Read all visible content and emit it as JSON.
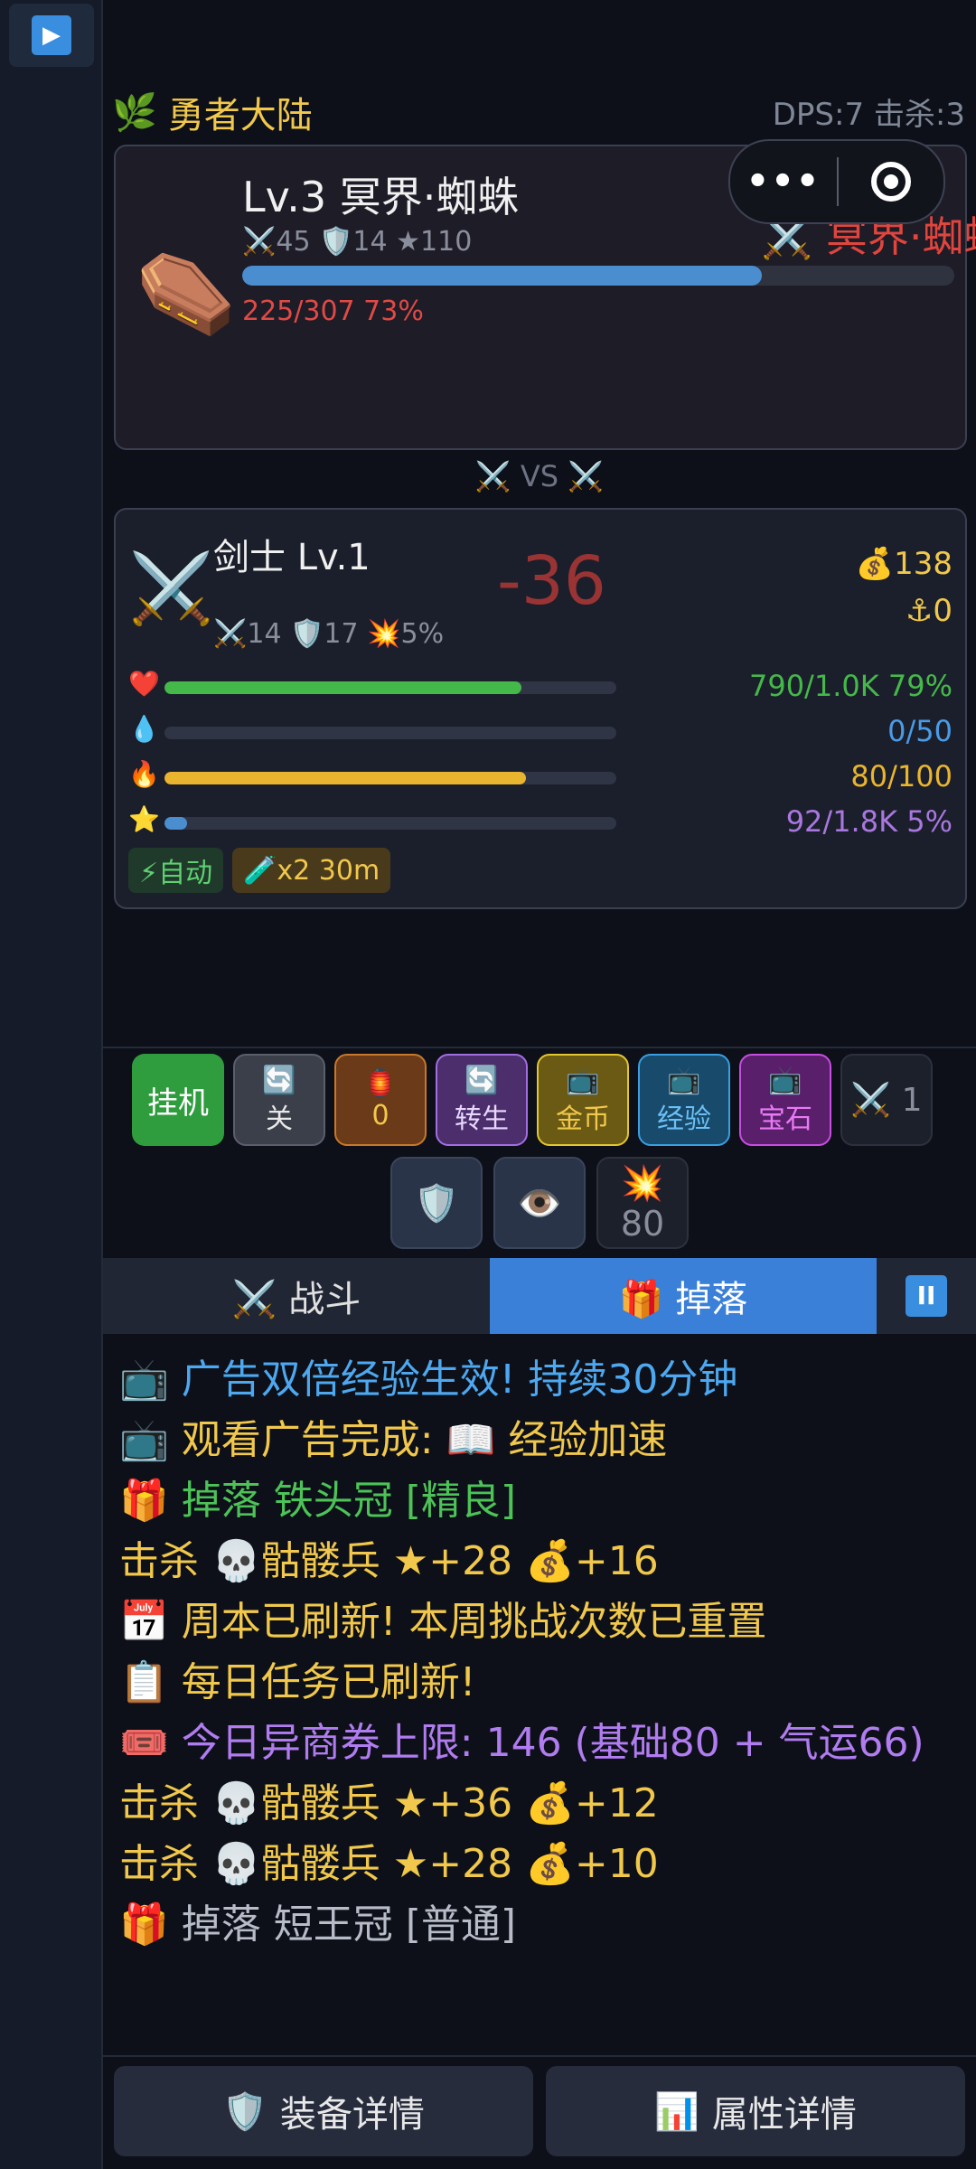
{
  "sidebar": {
    "play_icon": "play-icon"
  },
  "top": {
    "zone": "勇者大陆",
    "zone_icon": "🌿",
    "dps": "DPS:7",
    "kills": "击杀:3"
  },
  "enemy": {
    "icon": "⚰️",
    "title": "Lv.3 冥界·蜘蛛",
    "stats": "⚔️45 🛡️14 ★110",
    "hp_text": "225/307  73%",
    "hp_fraction": 0.73,
    "target_label": "⚔️ 冥界·蜘蛛",
    "menu_dots": "•••"
  },
  "vs": "⚔️ VS ⚔️",
  "hero": {
    "icon": "⚔️",
    "title": "剑士 Lv.1",
    "stats": "⚔️14 🛡️17 💥5%",
    "damage": "-36",
    "gold": "💰138",
    "anchor": "⚓0",
    "bars": [
      {
        "icon": "❤️",
        "value": "790/1.0K 79%",
        "fraction": 0.79,
        "color": "#45b84a",
        "text_color": "#45b84a"
      },
      {
        "icon": "💧",
        "value": "0/50",
        "fraction": 0.0,
        "color": "#3a8ee0",
        "text_color": "#4a9be6"
      },
      {
        "icon": "🔥",
        "value": "80/100",
        "fraction": 0.8,
        "color": "#e9b52e",
        "text_color": "#e9b52e"
      },
      {
        "icon": "⭐",
        "value": "92/1.8K 5%",
        "fraction": 0.05,
        "color": "#4a8ed0",
        "text_color": "#a977e0"
      }
    ],
    "tag_auto": "⚡自动",
    "tag_boost": "🧪x2 30m"
  },
  "actions": {
    "idle": "挂机",
    "toggle_icon": "🔄",
    "toggle": "关",
    "lantern_icon": "🏮",
    "lantern_count": "0",
    "rebirth_icon": "🔄",
    "rebirth": "转生",
    "tv_icon": "📺",
    "gold": "金币",
    "exp": "经验",
    "gem": "宝石",
    "battle_count": "⚔️ 1",
    "shield_icon": "🛡️",
    "eye_icon": "👁️",
    "burst_icon": "💥",
    "burst_count": "80"
  },
  "tabs": {
    "battle": "⚔️ 战斗",
    "drop": "🎁 掉落",
    "pause": "II"
  },
  "log": [
    {
      "text": "📺 广告双倍经验生效! 持续30分钟",
      "color": "#4da8f0"
    },
    {
      "text": "📺 观看广告完成: 📖 经验加速",
      "color": "#f1c84b"
    },
    {
      "text": "🎁 掉落 铁头冠 [精良]",
      "color": "#4cc257"
    },
    {
      "text": "击杀 💀骷髅兵  ★+28  💰+16",
      "color": "#f1c84b"
    },
    {
      "text": "📅 周本已刷新! 本周挑战次数已重置",
      "color": "#f1c84b"
    },
    {
      "text": "📋 每日任务已刷新!",
      "color": "#f1c84b"
    },
    {
      "text": "🎟️ 今日异商券上限: 146 (基础80 + 气运66)",
      "color": "#b07cf0"
    },
    {
      "text": "击杀 💀骷髅兵  ★+36  💰+12",
      "color": "#f1c84b"
    },
    {
      "text": "击杀 💀骷髅兵  ★+28  💰+10",
      "color": "#f1c84b"
    },
    {
      "text": "🎁 掉落 短王冠 [普通]",
      "color": "#b8bcc8"
    }
  ],
  "bottom": {
    "equip": "装备详情",
    "equip_icon": "🛡️",
    "attr": "属性详情",
    "attr_icon": "📊"
  }
}
